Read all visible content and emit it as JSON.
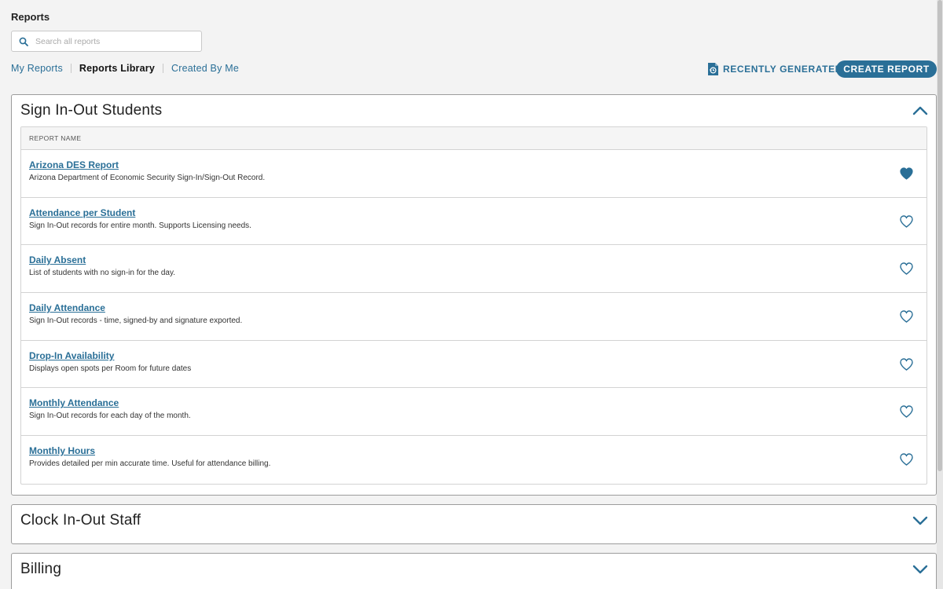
{
  "page": {
    "title": "Reports"
  },
  "search": {
    "placeholder": "Search all reports"
  },
  "tabs": [
    {
      "label": "My Reports",
      "active": false
    },
    {
      "label": "Reports Library",
      "active": true
    },
    {
      "label": "Created By Me",
      "active": false
    }
  ],
  "actions": {
    "recently_generated": "RECENTLY GENERATED",
    "create_report": "CREATE REPORT"
  },
  "sections": [
    {
      "title": "Sign In-Out Students",
      "expanded": true,
      "column_header": "REPORT NAME",
      "reports": [
        {
          "name": "Arizona DES Report",
          "description": "Arizona Department of Economic Security Sign-In/Sign-Out Record.",
          "favorite": true
        },
        {
          "name": "Attendance per Student",
          "description": "Sign In-Out records for entire month. Supports Licensing needs.",
          "favorite": false
        },
        {
          "name": "Daily Absent",
          "description": "List of students with no sign-in for the day.",
          "favorite": false
        },
        {
          "name": "Daily Attendance",
          "description": "Sign In-Out records - time, signed-by and signature exported.",
          "favorite": false
        },
        {
          "name": "Drop-In Availability",
          "description": "Displays open spots per Room for future dates",
          "favorite": false
        },
        {
          "name": "Monthly Attendance",
          "description": "Sign In-Out records for each day of the month.",
          "favorite": false
        },
        {
          "name": "Monthly Hours",
          "description": "Provides detailed per min accurate time. Useful for attendance billing.",
          "favorite": false
        }
      ]
    },
    {
      "title": "Clock In-Out Staff",
      "expanded": false
    },
    {
      "title": "Billing",
      "expanded": false
    }
  ],
  "colors": {
    "accent": "#2a6f97",
    "border": "#9c9c9c",
    "table_header_bg": "#f5f5f5"
  },
  "icons": {
    "search": "search-icon",
    "recent": "document-history-icon",
    "collapse": "chevron-up-icon",
    "expand": "chevron-down-icon",
    "favorite_on": "heart-filled-icon",
    "favorite_off": "heart-outline-icon"
  }
}
